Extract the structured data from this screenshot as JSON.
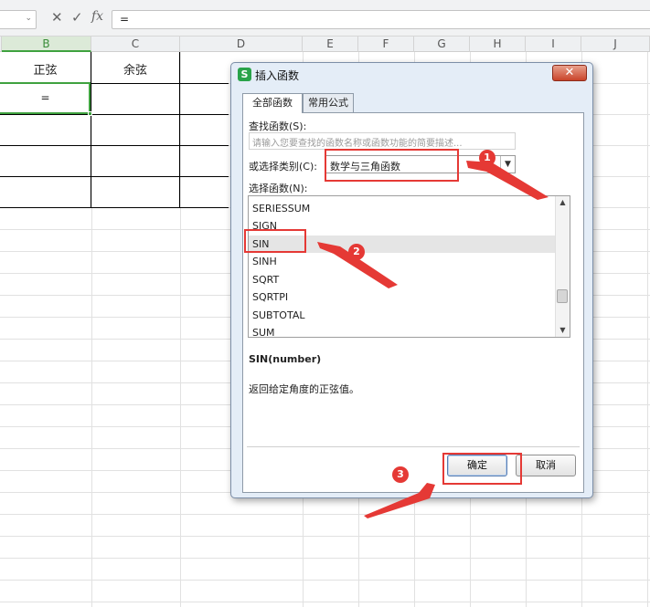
{
  "formula_bar": {
    "fn_icon": "fx-icon",
    "cancel_icon": "close-icon",
    "confirm_icon": "check-icon",
    "fx_label": "fx",
    "formula_value": "="
  },
  "columns": [
    "B",
    "C",
    "D",
    "E",
    "F",
    "G",
    "H",
    "I",
    "J"
  ],
  "cells": {
    "b1": "正弦",
    "c1": "余弦",
    "b2": "="
  },
  "dialog": {
    "title": "插入函数",
    "logo": "S",
    "close_label": "✕",
    "tabs": [
      "全部函数",
      "常用公式"
    ],
    "search_label": "查找函数(S):",
    "search_placeholder": "请输入您要查找的函数名称或函数功能的简要描述...",
    "category_label": "或选择类别(C):",
    "category_value": "数学与三角函数",
    "list_label": "选择函数(N):",
    "functions": [
      "SERIESSUM",
      "SIGN",
      "SIN",
      "SINH",
      "SQRT",
      "SQRTPI",
      "SUBTOTAL",
      "SUM"
    ],
    "selected_function": "SIN",
    "signature": "SIN(number)",
    "description": "返回给定角度的正弦值。",
    "ok_label": "确定",
    "cancel_label": "取消"
  },
  "annotations": {
    "badges": [
      "1",
      "2",
      "3"
    ],
    "color": "#e53935"
  }
}
